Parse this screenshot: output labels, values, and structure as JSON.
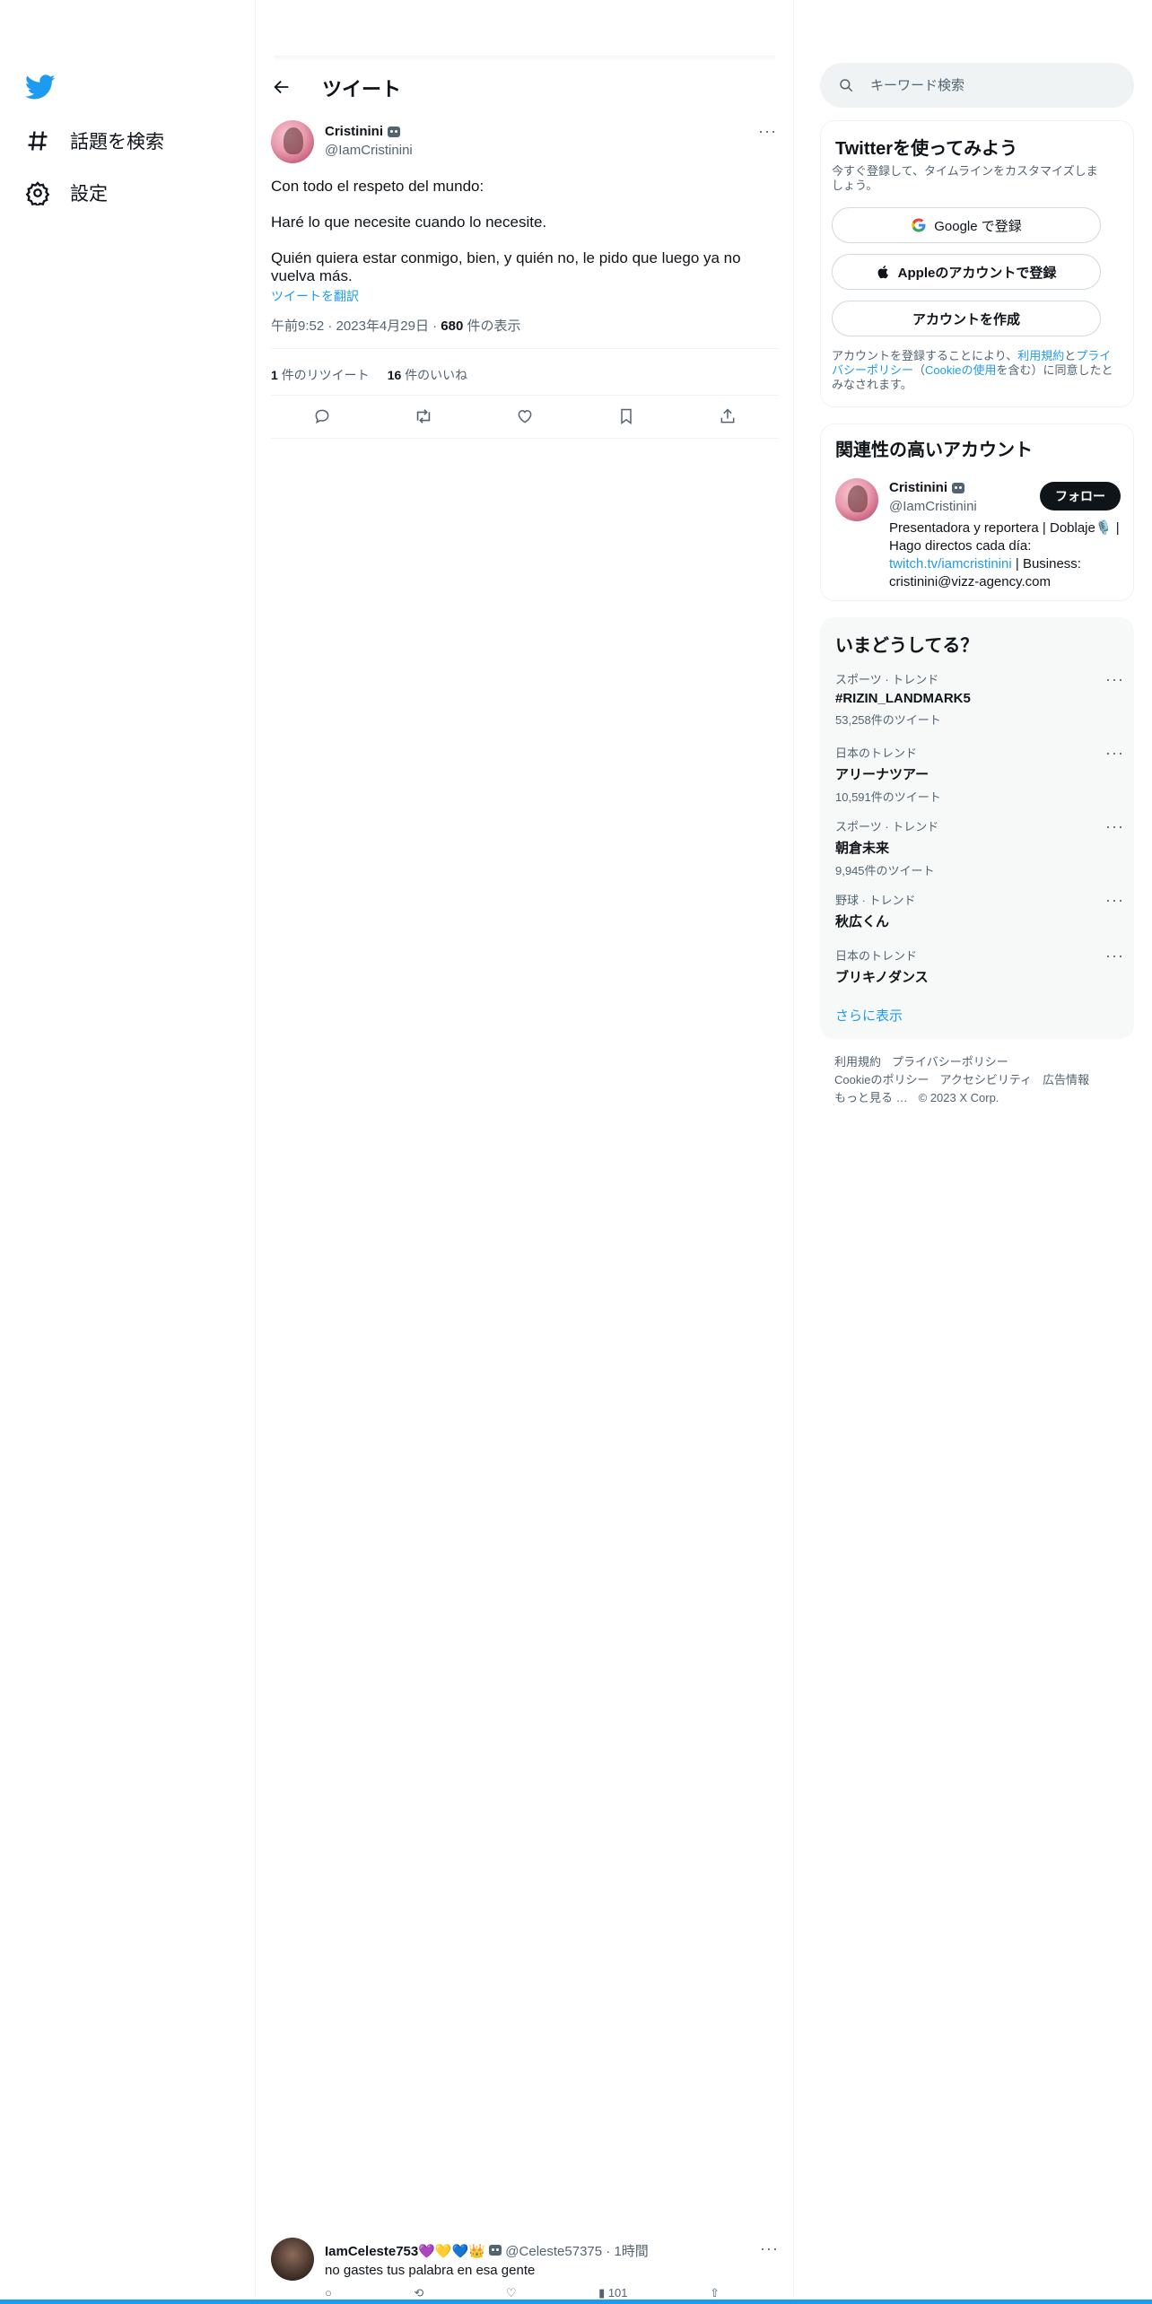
{
  "nav": {
    "explore_label": "話題を検索",
    "settings_label": "設定"
  },
  "header": {
    "title": "ツイート"
  },
  "tweet": {
    "display_name": "Cristinini",
    "handle": "@IamCristinini",
    "more": "···",
    "lines": [
      "Con todo el respeto del mundo:",
      "Haré lo que necesite cuando lo necesite.",
      "Quién quiera estar conmigo, bien, y quién no, le pido que luego ya no vuelva más."
    ],
    "translate": "ツイートを翻訳",
    "time": "午前9:52",
    "date": "2023年4月29日",
    "views_count": "680",
    "views_label": "件の表示",
    "retweets_count": "1",
    "retweets_label": "件のリツイート",
    "likes_count": "16",
    "likes_label": "件のいいね"
  },
  "reply": {
    "display_name": "IamCeleste753💜💛💙👑",
    "handle": "@Celeste57375",
    "time": "1時間",
    "text": "no gastes tus palabra en esa gente",
    "views": "101",
    "more": "···"
  },
  "search": {
    "placeholder": "キーワード検索"
  },
  "signup": {
    "title": "Twitterを使ってみよう",
    "subtitle": "今すぐ登録して、タイムラインをカスタマイズしましょう。",
    "google_label": "Google で登録",
    "apple_label": "Appleのアカウントで登録",
    "create_label": "アカウントを作成",
    "terms_prefix": "アカウントを登録することにより、",
    "terms_link": "利用規約",
    "terms_and": "と",
    "privacy_link": "プライバシーポリシー",
    "terms_paren_open": "（",
    "cookie_link": "Cookieの使用",
    "terms_suffix": "を含む）に同意したとみなされます。"
  },
  "related": {
    "title": "関連性の高いアカウント",
    "display_name": "Cristinini",
    "handle": "@IamCristinini",
    "follow_label": "フォロー",
    "bio_1": "Presentadora y reportera | Doblaje🎙️ | Hago directos cada día:",
    "bio_link": "twitch.tv/iamcristinini",
    "bio_2": "| Business: cristinini@vizz-agency.com"
  },
  "trends": {
    "title": "いまどうしてる？",
    "items": [
      {
        "category": "スポーツ · トレンド",
        "name": "#RIZIN_LANDMARK5",
        "count": "53,258件のツイート"
      },
      {
        "category": "日本のトレンド",
        "name": "アリーナツアー",
        "count": "10,591件のツイート"
      },
      {
        "category": "スポーツ · トレンド",
        "name": "朝倉未来",
        "count": "9,945件のツイート"
      },
      {
        "category": "野球 · トレンド",
        "name": "秋広くん",
        "count": ""
      },
      {
        "category": "日本のトレンド",
        "name": "ブリキノダンス",
        "count": ""
      }
    ],
    "show_more": "さらに表示",
    "more": "···"
  },
  "footer": {
    "terms": "利用規約",
    "privacy": "プライバシーポリシー",
    "cookie": "Cookieのポリシー",
    "accessibility": "アクセシビリティ",
    "ads": "広告情報",
    "more": "もっと見る …",
    "copyright": "© 2023 X Corp."
  },
  "colors": {
    "accent": "#1d9bf0",
    "text": "#0f1419",
    "muted": "#536471",
    "border": "#eff3f4"
  }
}
